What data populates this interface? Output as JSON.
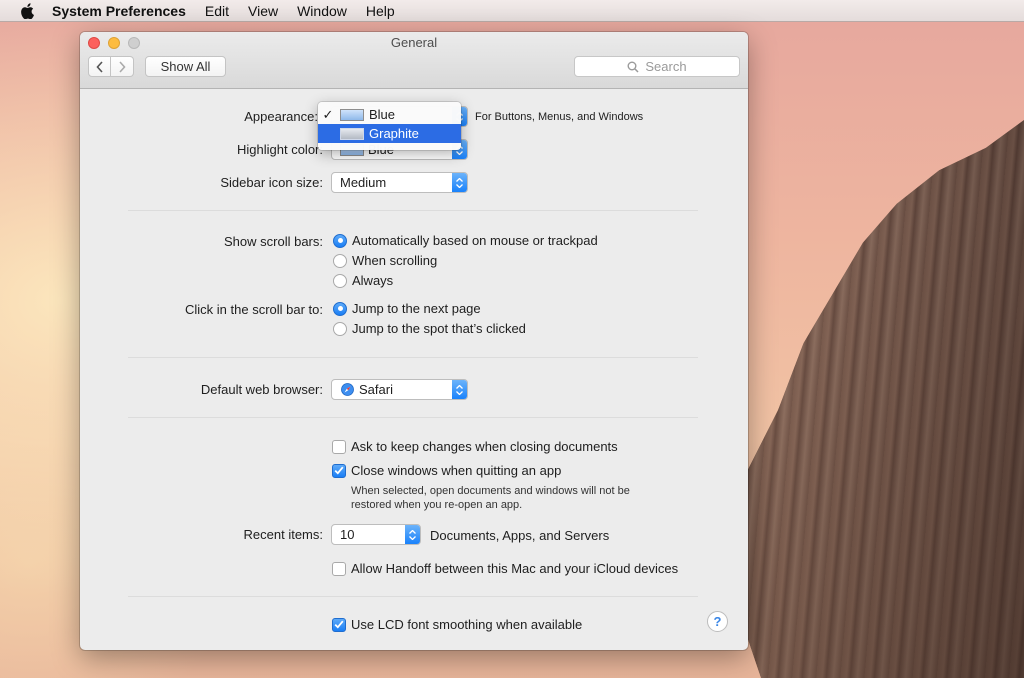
{
  "menubar": {
    "app_name": "System Preferences",
    "items": [
      "Edit",
      "View",
      "Window",
      "Help"
    ]
  },
  "window": {
    "title": "General",
    "show_all": "Show All",
    "search_placeholder": "Search"
  },
  "appearance": {
    "label": "Appearance:",
    "note": "For Buttons, Menus, and Windows",
    "menu": [
      {
        "label": "Blue",
        "checked": true
      },
      {
        "label": "Graphite",
        "highlighted": true
      }
    ]
  },
  "highlight": {
    "label": "Highlight color:",
    "value": "Blue"
  },
  "sidebar_icon": {
    "label": "Sidebar icon size:",
    "value": "Medium"
  },
  "scroll_bars": {
    "label": "Show scroll bars:",
    "options": [
      "Automatically based on mouse or trackpad",
      "When scrolling",
      "Always"
    ],
    "selected": 0
  },
  "click_scroll": {
    "label": "Click in the scroll bar to:",
    "options": [
      "Jump to the next page",
      "Jump to the spot that’s clicked"
    ],
    "selected": 0
  },
  "browser": {
    "label": "Default web browser:",
    "value": "Safari"
  },
  "documents": {
    "ask_keep": {
      "label": "Ask to keep changes when closing documents",
      "checked": false
    },
    "close_windows": {
      "label": "Close windows when quitting an app",
      "checked": true
    },
    "note_line1": "When selected, open documents and windows will not be",
    "note_line2": "restored when you re-open an app."
  },
  "recent": {
    "label": "Recent items:",
    "value": "10",
    "suffix": "Documents, Apps, and Servers"
  },
  "handoff": {
    "label": "Allow Handoff between this Mac and your iCloud devices",
    "checked": false
  },
  "lcd": {
    "label": "Use LCD font smoothing when available",
    "checked": true
  },
  "help": "?"
}
